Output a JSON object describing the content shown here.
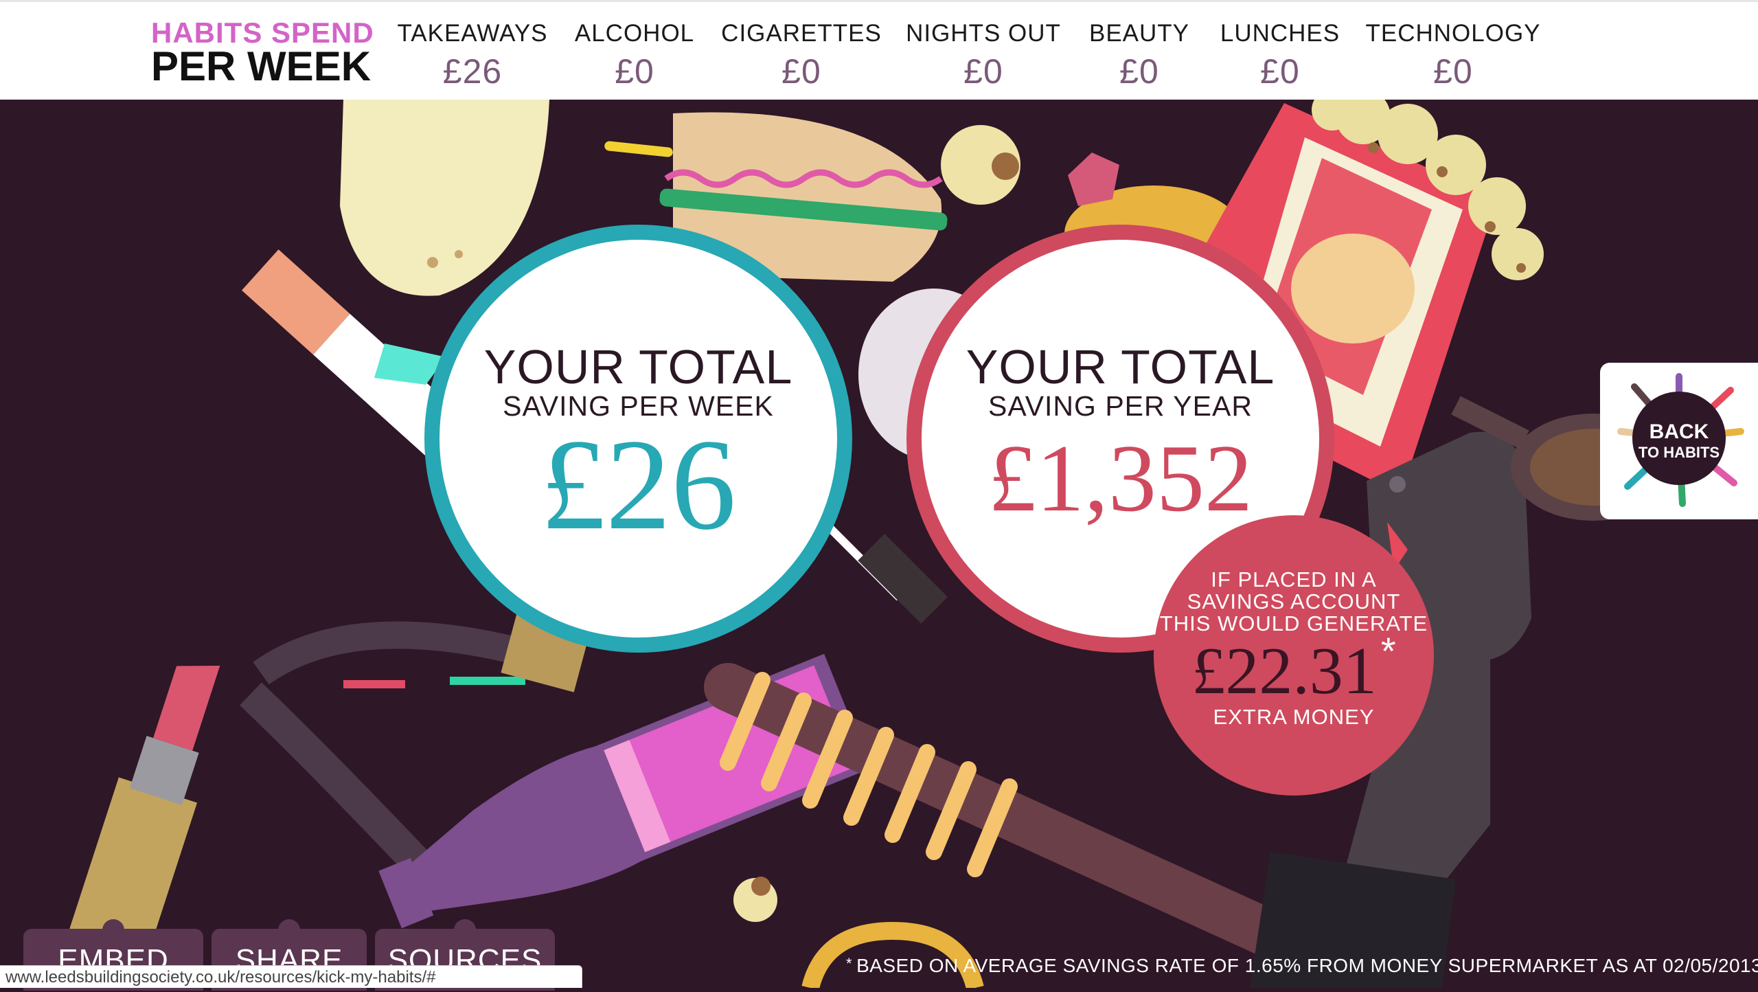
{
  "header": {
    "brand_top": "HABITS SPEND",
    "brand_bottom": "PER WEEK",
    "habits": [
      {
        "label": "TAKEAWAYS",
        "value": "£26"
      },
      {
        "label": "ALCOHOL",
        "value": "£0"
      },
      {
        "label": "CIGARETTES",
        "value": "£0"
      },
      {
        "label": "NIGHTS OUT",
        "value": "£0"
      },
      {
        "label": "BEAUTY",
        "value": "£0"
      },
      {
        "label": "LUNCHES",
        "value": "£0"
      },
      {
        "label": "TECHNOLOGY",
        "value": "£0"
      }
    ]
  },
  "week_circle": {
    "title": "YOUR TOTAL",
    "subtitle": "SAVING PER WEEK",
    "amount": "£26"
  },
  "year_circle": {
    "title": "YOUR TOTAL",
    "subtitle": "SAVING PER YEAR",
    "amount": "£1,352"
  },
  "interest": {
    "line1": "IF PLACED IN A",
    "line2": "SAVINGS ACCOUNT",
    "line3": "THIS WOULD GENERATE",
    "amount": "£22.31",
    "asterisk": "*",
    "extra": "EXTRA MONEY"
  },
  "back_tab": {
    "line1": "BACK",
    "line2": "TO HABITS"
  },
  "tabs": {
    "embed": "EMBED",
    "share": "SHARE",
    "sources": "SOURCES"
  },
  "footnote": {
    "asterisk": "*",
    "text": "BASED ON AVERAGE SAVINGS RATE OF 1.65% FROM MONEY SUPERMARKET AS AT 02/05/2013"
  },
  "status_url": "www.leedsbuildingsociety.co.uk/resources/kick-my-habits/#",
  "colors": {
    "background": "#2e1727",
    "week_accent": "#27a8b4",
    "year_accent": "#cf4a5e",
    "brand_pink": "#d463c8",
    "habit_value": "#7a5a78"
  }
}
